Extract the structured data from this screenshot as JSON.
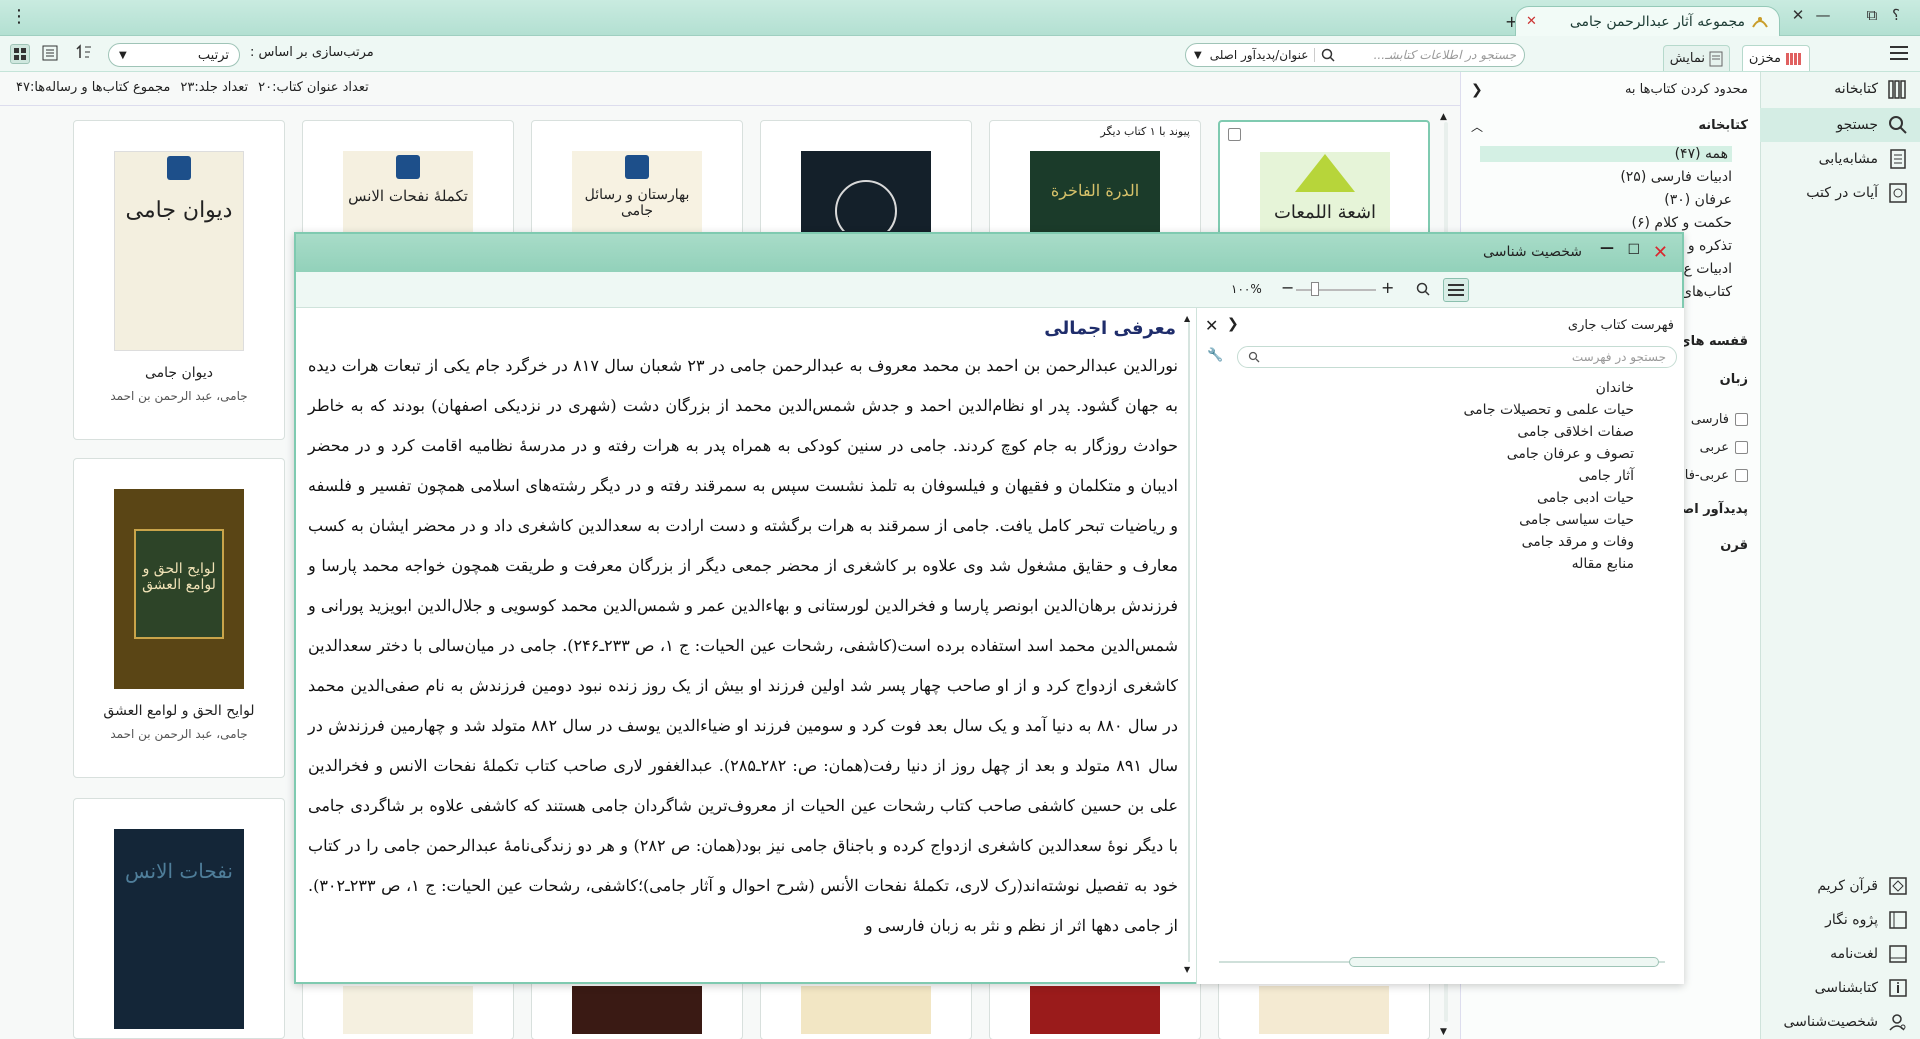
{
  "window": {
    "title": "مجموعه آثار عبدالرحمن جامی",
    "new_tab": "+",
    "help": "؟",
    "restore": "⧉",
    "minimize": "—",
    "close": "✕",
    "menu": "⋮"
  },
  "toolbar": {
    "tab_makhzan": "مخزن",
    "tab_namayesh": "نمایش",
    "search_placeholder": "جستجو در اطلاعات کتابشـ...",
    "search_field": "عنوان/پدیدآور اصلی",
    "sort_label": "مرتب‌سازی بر اساس :",
    "sort_value": "ترتیب"
  },
  "info": {
    "titles": "تعداد عنوان کتاب:۲۰",
    "volumes": "تعداد جلد:۲۳",
    "total": "مجموع کتاب‌ها و رساله‌ها:۴۷"
  },
  "sidebar": {
    "items": [
      {
        "label": "کتابخانه",
        "icon": "library-icon"
      },
      {
        "label": "جستجو",
        "icon": "search-icon"
      },
      {
        "label": "مشابه‌یابی",
        "icon": "similar-icon"
      },
      {
        "label": "آیات در کتب",
        "icon": "verses-icon"
      }
    ],
    "bottom": [
      {
        "label": "قرآن کریم",
        "icon": "quran-icon"
      },
      {
        "label": "پژوه نگار",
        "icon": "notes-icon"
      },
      {
        "label": "لغت‌نامه",
        "icon": "dictionary-icon"
      },
      {
        "label": "کتابشناسی",
        "icon": "bibliography-icon"
      },
      {
        "label": "شخصیت‌شناسی",
        "icon": "person-icon"
      }
    ]
  },
  "filter": {
    "header": "محدود کردن کتاب‌ها به",
    "library_title": "کتابخانه",
    "categories": [
      "همه (۴۷)",
      "ادبیات فارسی (۲۵)",
      "عرفان (۳۰)",
      "حکمت و کلام (۶)",
      "تذکره و",
      "ادبیات ع",
      "کتاب‌های"
    ],
    "shelves": "قفسه های",
    "language": "زبان",
    "langs": [
      "فارسی",
      "عربی",
      "عربی-فار"
    ],
    "author": "پدیدآور اصلی",
    "century": "قرن"
  },
  "books": {
    "link_note": "پیوند با ۱ کتاب دیگر",
    "b1_title": "دیوان جامی",
    "b1_author": "جامی، عبد الرحمن بن احمد",
    "b2_title": "لوایح الحق و لوامع العشق",
    "b2_author": "جامی، عبد الرحمن بن احمد",
    "cover_text_1": "دیوان جامی",
    "cover_text_2": "لوایح الحق و لوامع العشق",
    "cover_text_3": "نفحات الانس",
    "cover_text_4": "تکملهٔ نفحات الانس",
    "cover_text_5": "بهارستان و رسائل جامی",
    "cover_text_6": "الدرة الفاخرة",
    "cover_text_7": "اشعة اللمعات"
  },
  "modal": {
    "title": "شخصیت شناسی",
    "zoom": "۱۰۰%",
    "toc_title": "فهرست کتاب جاری",
    "toc_search": "جستجو در فهرست",
    "toc_items": [
      "خاندان",
      "حیات علمی و تحصیلات جامی",
      "صفات اخلاقی جامی",
      "تصوف و عرفان جامی",
      "آثار جامی",
      "حیات ادبی جامی",
      "حیات سیاسی جامی",
      "وفات و مرقد جامی",
      "منابع مقاله"
    ],
    "heading": "معرفی اجمالی",
    "body": "نورالدین عبدالرحمن بن احمد بن محمد معروف به عبدالرحمن جامی در ۲۳ شعبان سال ۸۱۷ در خرگرد جام یکی از تبعات هرات دیده به جهان گشود. پدر او نظام‌الدین احمد و جدش شمس‌الدین محمد از بزرگان دشت (شهری در نزدیکی اصفهان) بودند که به خاطر حوادث روزگار به جام کوچ کردند. جامی در سنین کودکی به همراه پدر به هرات رفته و در مدرسهٔ نظامیه اقامت کرد و در محضر ادیبان و متکلمان و فقیهان و فیلسوفان به تلمذ نشست سپس به سمرقند رفته و در دیگر رشته‌های اسلامی همچون تفسیر و فلسفه و ریاضیات تبحر کامل یافت. جامی از سمرقند به هرات برگشته و دست ارادت به سعدالدین کاشغری داد و در محضر ایشان به کسب معارف و حقایق مشغول شد وی علاوه بر کاشغری از محضر جمعی دیگر از بزرگان معرفت و طریقت همچون خواجه محمد پارسا و فرزندش برهان‌الدین ابونصر پارسا و فخرالدین لورستانی و بهاءالدین عمر و شمس‌الدین محمد کوسویی و جلال‌الدین ابویزید پورانی و شمس‌الدین محمد اسد استفاده برده است(کاشفی، رشحات عین الحیات: ج ۱، ص ۲۳۳ـ۲۴۶). جامی در میان‌سالی با دختر سعدالدین کاشغری ازدواج کرد و از او صاحب چهار پسر شد اولین فرزند او بیش از یک روز زنده نبود دومین فرزندش به نام صفی‌الدین محمد در سال ۸۸۰ به دنیا آمد و یک سال بعد فوت کرد و سومین فرزند او ضیاءالدین یوسف در سال ۸۸۲ متولد شد و چهارمین فرزندش در سال ۸۹۱ متولد و بعد از چهل روز از دنیا رفت(همان: ص: ۲۸۲ـ۲۸۵). عبدالغفور لاری صاحب کتاب تکملهٔ نفحات الانس و فخرالدین علی بن حسین کاشفی صاحب کتاب رشحات عین الحیات از معروف‌ترین شاگردان جامی هستند که کاشفی علاوه بر شاگردی جامی با دیگر نوهٔ سعدالدین کاشغری ازدواج کرده و باجناق جامی نیز بود(همان: ص ۲۸۲) و هر دو زندگی‌نامهٔ عبدالرحمن جامی را در کتاب خود به تفصیل نوشته‌اند(رک لاری، تکملهٔ نفحات الأنس (شرح احوال و آثار جامی)؛کاشفی، رشحات عین الحیات: ج ۱، ص ۲۳۳ـ۳۰۲). از جامی دهها اثر از نظم و نثر به زبان فارسی و"
  },
  "colors": {
    "accent": "#92d1ba",
    "close": "#d9272e",
    "heading": "#1f2d6b"
  }
}
